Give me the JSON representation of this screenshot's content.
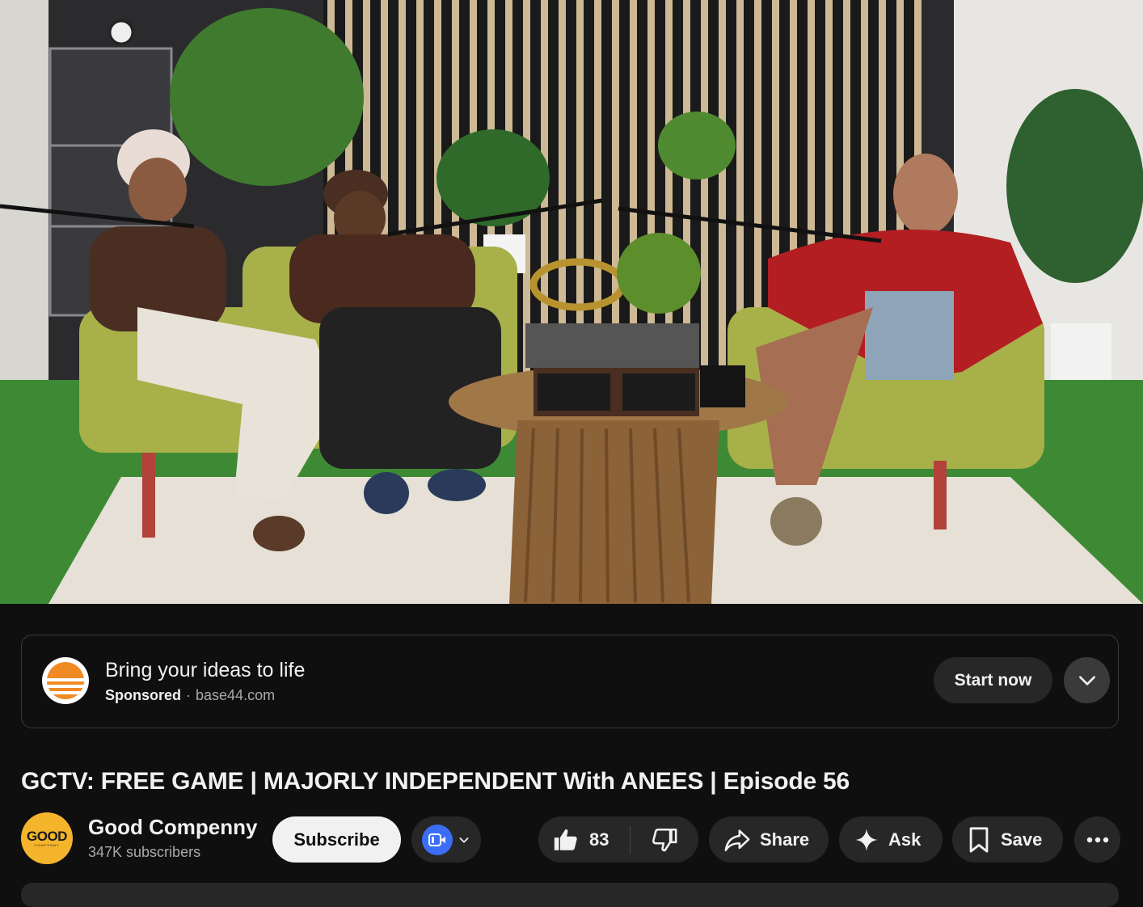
{
  "player": {
    "scene_description_icon": "podcast-studio-scene"
  },
  "ad": {
    "title": "Bring your ideas to life",
    "sponsored_label": "Sponsored",
    "separator": "·",
    "domain": "base44.com",
    "cta_label": "Start now",
    "logo_icon": "base44-logo-icon",
    "expand_icon": "chevron-down-icon"
  },
  "video": {
    "title": "GCTV: FREE GAME | MAJORLY INDEPENDENT With ANEES | Episode 56"
  },
  "channel": {
    "avatar_text": "GOOD",
    "avatar_subtext": "COMPENNY",
    "name": "Good Compenny",
    "subscribers": "347K subscribers",
    "subscribe_label": "Subscribe"
  },
  "actions": {
    "like_count": "83",
    "share_label": "Share",
    "ask_label": "Ask",
    "save_label": "Save"
  },
  "colors": {
    "background": "#0f0f0f",
    "pill": "#272727",
    "subscribe_bg": "#f1f1f1",
    "avatar_bg": "#f4b52c",
    "join_badge": "#3b6ef5"
  }
}
